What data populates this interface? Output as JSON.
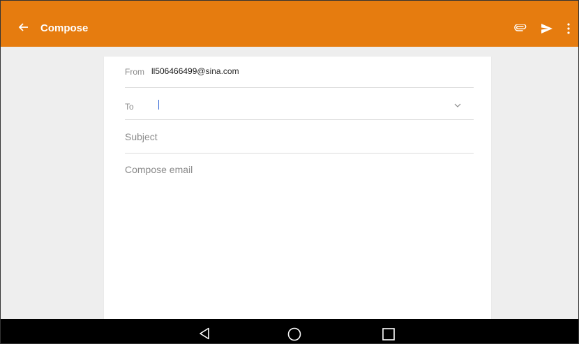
{
  "appbar": {
    "title": "Compose",
    "back_icon": "arrow-left-icon",
    "attach_icon": "paperclip-icon",
    "send_icon": "send-icon",
    "more_icon": "more-vert-icon",
    "color": "#e67c0f"
  },
  "compose": {
    "from_label": "From",
    "from_value": "ll506466499@sina.com",
    "to_label": "To",
    "to_value": "",
    "subject_placeholder": "Subject",
    "body_placeholder": "Compose email"
  },
  "navbar": {
    "back_icon": "nav-back-icon",
    "home_icon": "nav-home-icon",
    "recents_icon": "nav-recents-icon"
  }
}
